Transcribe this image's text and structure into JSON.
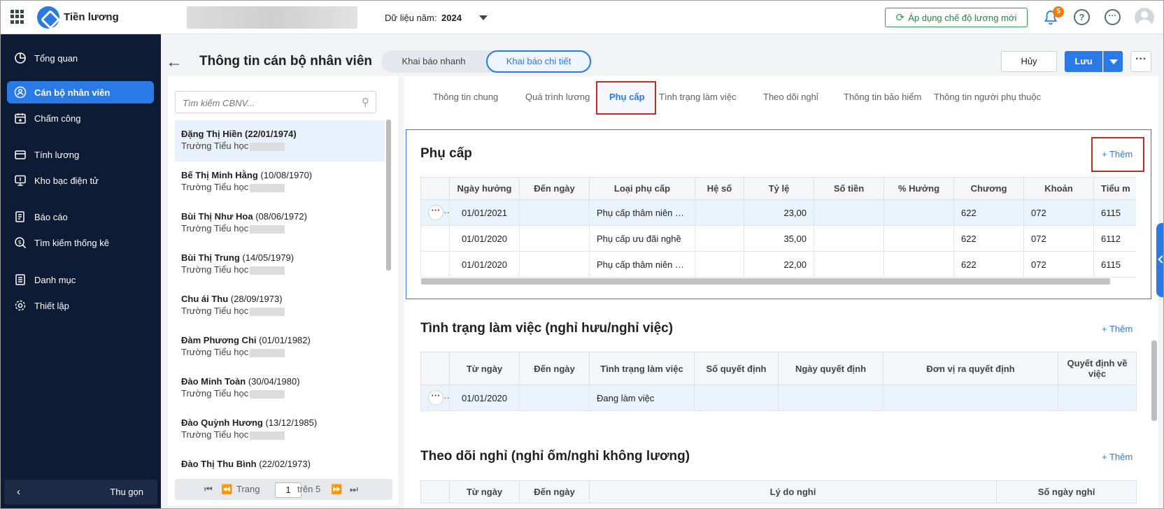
{
  "topbar": {
    "app_name": "Tiền lương",
    "year_label": "Dữ liệu năm:",
    "year_value": "2024",
    "apply_button": "Áp dụng chế độ lương mới",
    "notification_count": "5",
    "help_glyph": "?",
    "more_glyph": "···"
  },
  "sidebar": {
    "items": [
      {
        "label": "Tổng quan",
        "icon": "pie-chart-icon"
      },
      {
        "label": "Cán bộ nhân viên",
        "icon": "people-icon",
        "active": true
      },
      {
        "label": "Chấm công",
        "icon": "calendar-icon"
      },
      {
        "label": "Tính lương",
        "icon": "payroll-icon"
      },
      {
        "label": "Kho bạc điện tử",
        "icon": "monitor-icon"
      },
      {
        "label": "Báo cáo",
        "icon": "report-icon"
      },
      {
        "label": "Tìm kiếm thống kê",
        "icon": "search-stats-icon"
      },
      {
        "label": "Danh mục",
        "icon": "list-icon"
      },
      {
        "label": "Thiết lập",
        "icon": "gear-icon"
      }
    ],
    "collapse_label": "Thu gọn"
  },
  "header": {
    "title": "Thông tin cán bộ nhân viên",
    "mode_quick": "Khai báo nhanh",
    "mode_detail": "Khai báo chi tiết",
    "cancel": "Hủy",
    "save": "Lưu",
    "more": "···"
  },
  "employees": {
    "search_placeholder": "Tìm kiếm CBNV...",
    "list": [
      {
        "name": "Đặng Thị Hiền",
        "dob": "(22/01/1974)",
        "school": "Trường Tiểu học"
      },
      {
        "name": "Bế Thị Minh Hằng",
        "dob": "(10/08/1970)",
        "school": "Trường Tiểu học"
      },
      {
        "name": "Bùi Thị Như Hoa",
        "dob": "(08/06/1972)",
        "school": "Trường Tiểu học"
      },
      {
        "name": "Bùi Thị Trung",
        "dob": "(14/05/1979)",
        "school": "Trường Tiểu học"
      },
      {
        "name": "Chu ái Thu",
        "dob": "(28/09/1973)",
        "school": "Trường Tiểu học"
      },
      {
        "name": "Đàm Phương Chi",
        "dob": "(01/01/1982)",
        "school": "Trường Tiểu học"
      },
      {
        "name": "Đào Minh Toàn",
        "dob": "(30/04/1980)",
        "school": "Trường Tiểu học"
      },
      {
        "name": "Đào Quỳnh Hương",
        "dob": "(13/12/1985)",
        "school": "Trường Tiểu học"
      },
      {
        "name": "Đào Thị Thu Bình",
        "dob": "(22/02/1973)",
        "school": ""
      }
    ],
    "pager": {
      "page_label": "Trang",
      "page": "1",
      "of_label": "trên 5"
    }
  },
  "tabs": [
    "Thông tin chung",
    "Quá trình lương",
    "Phụ cấp",
    "Tình trạng làm việc",
    "Theo dõi nghỉ",
    "Thông tin bảo hiểm",
    "Thông tin người phụ thuộc"
  ],
  "allowance": {
    "title": "Phụ cấp",
    "add": "+ Thêm",
    "columns": [
      "Ngày hưởng",
      "Đến ngày",
      "Loại phụ cấp",
      "Hệ số",
      "Tỷ lệ",
      "Số tiền",
      "% Hưởng",
      "Chương",
      "Khoản",
      "Tiểu m"
    ],
    "rows": [
      [
        "01/01/2021",
        "",
        "Phụ cấp thâm niên n...",
        "",
        "23,00",
        "",
        "",
        "622",
        "072",
        "6115"
      ],
      [
        "01/01/2020",
        "",
        "Phụ cấp ưu đãi nghề",
        "",
        "35,00",
        "",
        "",
        "622",
        "072",
        "6112"
      ],
      [
        "01/01/2020",
        "",
        "Phụ cấp thâm niên n...",
        "",
        "22,00",
        "",
        "",
        "622",
        "072",
        "6115"
      ]
    ]
  },
  "work_status": {
    "title": "Tình trạng làm việc (nghỉ hưu/nghỉ việc)",
    "add": "+ Thêm",
    "columns": [
      "Từ ngày",
      "Đến ngày",
      "Tình trạng làm việc",
      "Số quyết định",
      "Ngày quyết định",
      "Đơn vị ra quyết định",
      "Quyết định về việc"
    ],
    "rows": [
      [
        "01/01/2020",
        "",
        "Đang làm việc",
        "",
        "",
        "",
        ""
      ]
    ]
  },
  "leave": {
    "title": "Theo dõi nghỉ (nghỉ ốm/nghỉ không lương)",
    "add": "+ Thêm",
    "columns": [
      "Từ ngày",
      "Đến ngày",
      "Lý do nghỉ",
      "Số ngày nghỉ"
    ]
  },
  "colors": {
    "accent": "#2979e6",
    "sidebar_bg": "#0d1b34",
    "highlight_box": "#c62828",
    "apply_green": "#2e9e4f",
    "badge": "#f57c00"
  }
}
